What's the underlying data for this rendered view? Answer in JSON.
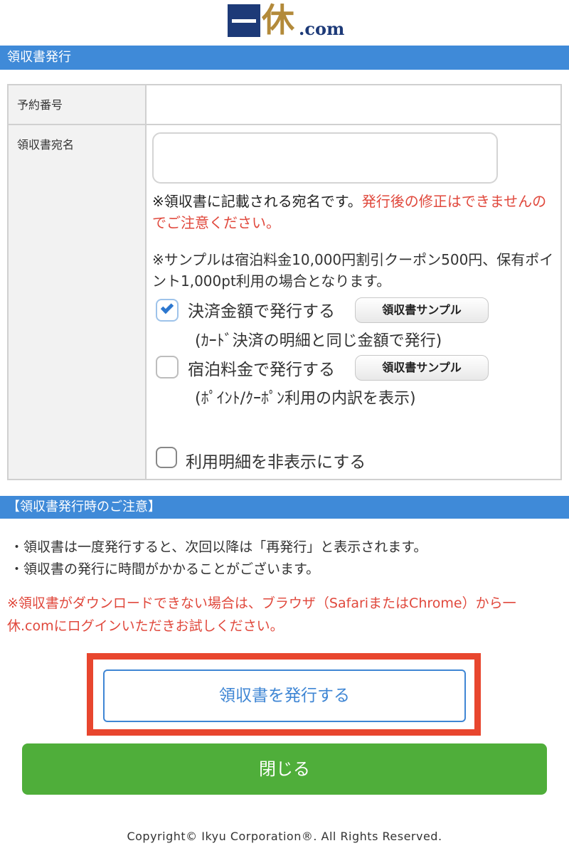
{
  "logo": {
    "kanji": "休",
    "suffix": ".com"
  },
  "sections": {
    "receipt_issue": "領収書発行",
    "notes_title": "【領収書発行時のご注意】"
  },
  "form": {
    "reservation_label": "予約番号",
    "reservation_value": "",
    "addressee_label": "領収書宛名",
    "addressee_value": "",
    "addressee_note_black": "※領収書に記載される宛名です。",
    "addressee_note_red": "発行後の修正はできませんのでご注意ください。",
    "sample_note": "※サンプルは宿泊料金10,000円割引クーポン500円、保有ポイント1,000pt利用の場合となります。",
    "option1": {
      "label": "決済金額で発行する",
      "sub": "(ｶｰﾄﾞ決済の明細と同じ金額で発行)",
      "checked": true
    },
    "option2": {
      "label": "宿泊料金で発行する",
      "sub": "(ﾎﾟｲﾝﾄ/ｸｰﾎﾟﾝ利用の内訳を表示)",
      "checked": false
    },
    "sample_button": "領収書サンプル",
    "hide_details_label": "利用明細を非表示にする"
  },
  "notes": [
    "・領収書は一度発行すると、次回以降は「再発行」と表示されます。",
    "・領収書の発行に時間がかかることがございます。"
  ],
  "warning": "※領収書がダウンロードできない場合は、ブラウザ（SafariまたはChrome）から一休.comにログインいただきお試しください。",
  "buttons": {
    "issue": "領収書を発行する",
    "close": "閉じる"
  },
  "footer": "Copyright© Ikyu Corporation®. All Rights Reserved.",
  "colors": {
    "section_bar": "#3f8ad8",
    "red_text": "#e0483c",
    "close_button": "#4fae3a",
    "issue_button_border": "#3f86d4",
    "highlight_frame": "#e8462e"
  }
}
